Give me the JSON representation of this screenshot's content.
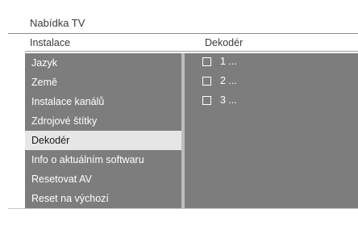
{
  "menu": {
    "title": "Nabídka TV"
  },
  "columns": {
    "left": "Instalace",
    "right": "Dekodér"
  },
  "items": [
    {
      "label": "Jazyk"
    },
    {
      "label": "Země"
    },
    {
      "label": "Instalace kanálů"
    },
    {
      "label": "Zdrojové štítky"
    },
    {
      "label": "Dekodér",
      "selected": true
    },
    {
      "label": "Info o aktuálním softwaru"
    },
    {
      "label": "Resetovat AV"
    },
    {
      "label": "Reset na výchozí"
    }
  ],
  "decoder_options": [
    {
      "label": "1 ..."
    },
    {
      "label": "2 ..."
    },
    {
      "label": "3 ..."
    }
  ]
}
